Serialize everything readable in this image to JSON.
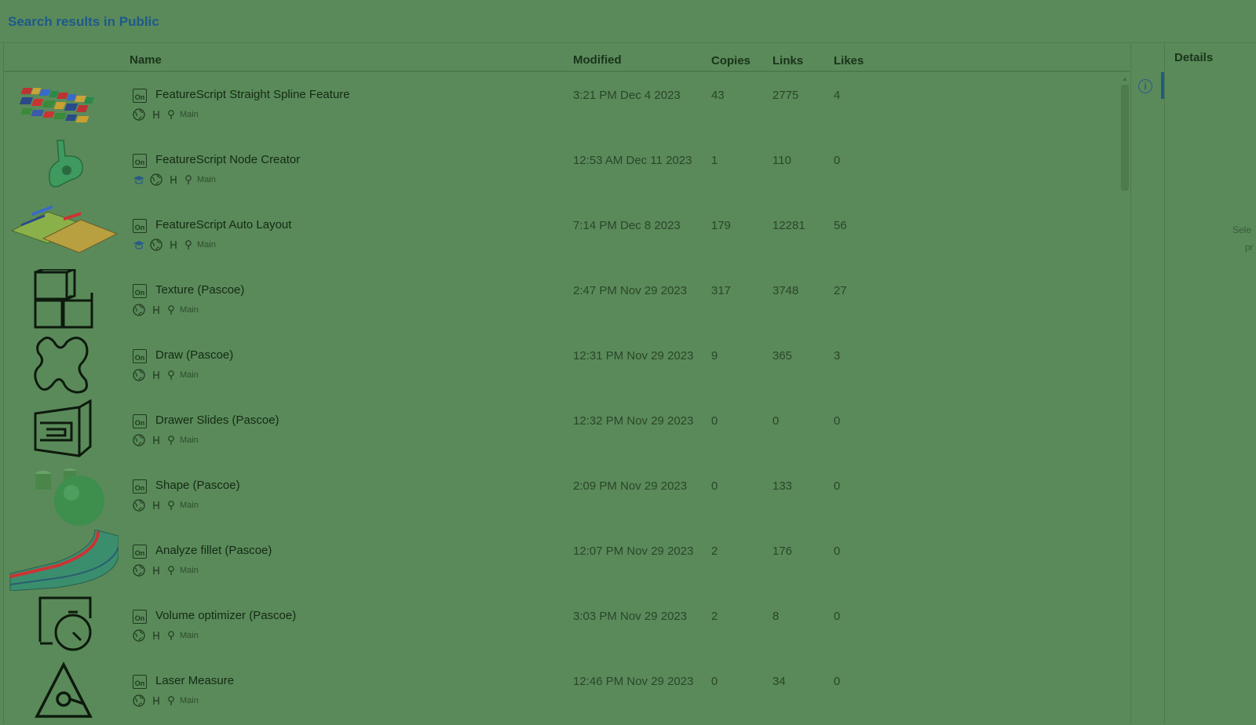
{
  "header": {
    "title": "Search results in Public"
  },
  "columns": {
    "name": "Name",
    "modified": "Modified",
    "copies": "Copies",
    "links": "Links",
    "likes": "Likes"
  },
  "details": {
    "title": "Details",
    "hint_line1": "Sele",
    "hint_line2": "pr"
  },
  "rows": [
    {
      "name": "FeatureScript Straight Spline Feature",
      "modified": "3:21 PM Dec 4 2023",
      "copies": "43",
      "links": "2775",
      "likes": "4",
      "branch": "Main",
      "thumb": "colorful-bars-thumbnail",
      "learning": false
    },
    {
      "name": "FeatureScript Node Creator",
      "modified": "12:53 AM Dec 11 2023",
      "copies": "1",
      "links": "110",
      "likes": "0",
      "branch": "Main",
      "thumb": "green-part-thumbnail",
      "learning": true
    },
    {
      "name": "FeatureScript Auto Layout",
      "modified": "7:14 PM Dec 8 2023",
      "copies": "179",
      "links": "12281",
      "likes": "56",
      "branch": "Main",
      "thumb": "layout-plates-thumbnail",
      "learning": true
    },
    {
      "name": "Texture (Pascoe)",
      "modified": "2:47 PM Nov 29 2023",
      "copies": "317",
      "links": "3748",
      "likes": "27",
      "branch": "Main",
      "thumb": "boxes-icon-thumbnail",
      "learning": false
    },
    {
      "name": "Draw (Pascoe)",
      "modified": "12:31 PM Nov 29 2023",
      "copies": "9",
      "links": "365",
      "likes": "3",
      "branch": "Main",
      "thumb": "squiggle-icon-thumbnail",
      "learning": false
    },
    {
      "name": "Drawer Slides (Pascoe)",
      "modified": "12:32 PM Nov 29 2023",
      "copies": "0",
      "links": "0",
      "likes": "0",
      "branch": "Main",
      "thumb": "drawer-slides-thumbnail",
      "learning": false
    },
    {
      "name": "Shape (Pascoe)",
      "modified": "2:09 PM Nov 29 2023",
      "copies": "0",
      "links": "133",
      "likes": "0",
      "branch": "Main",
      "thumb": "sphere-thumbnail",
      "learning": false
    },
    {
      "name": "Analyze fillet (Pascoe)",
      "modified": "12:07 PM Nov 29 2023",
      "copies": "2",
      "links": "176",
      "likes": "0",
      "branch": "Main",
      "thumb": "fillet-thumbnail",
      "learning": false
    },
    {
      "name": "Volume optimizer (Pascoe)",
      "modified": "3:03 PM Nov 29 2023",
      "copies": "2",
      "links": "8",
      "likes": "0",
      "branch": "Main",
      "thumb": "stopwatch-box-thumbnail",
      "learning": false
    },
    {
      "name": "Laser Measure",
      "modified": "12:46 PM Nov 29 2023",
      "copies": "0",
      "links": "34",
      "likes": "0",
      "branch": "Main",
      "thumb": "triangle-measure-thumbnail",
      "learning": false
    }
  ]
}
